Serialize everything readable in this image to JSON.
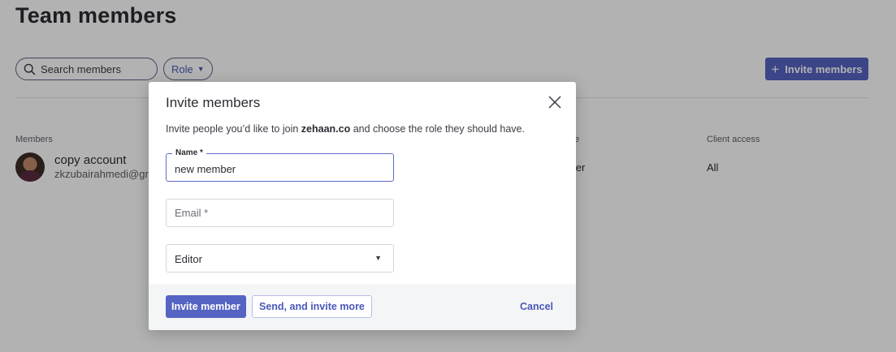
{
  "page": {
    "title": "Team members",
    "search": {
      "placeholder": "Search members"
    },
    "role_filter": {
      "label": "Role",
      "caret": "▼"
    },
    "invite_button": {
      "icon": "+",
      "label": "Invite members"
    },
    "columns": {
      "members": "Members",
      "role": "e",
      "client_access": "Client access"
    },
    "member": {
      "name": "copy account",
      "email": "zkzubairahmedi@gr",
      "role": "vner",
      "client_access": "All"
    }
  },
  "modal": {
    "title": "Invite members",
    "description_pre": "Invite people you’d like to join ",
    "description_org": "zehaan.co",
    "description_post": " and choose the role they should have.",
    "name_field": {
      "label": "Name *",
      "value": "new member"
    },
    "email_field": {
      "placeholder": "Email *"
    },
    "role_select": {
      "value": "Editor",
      "caret": "▼"
    },
    "buttons": {
      "invite": "Invite member",
      "invite_more": "Send, and invite more",
      "cancel": "Cancel"
    }
  },
  "colors": {
    "accent": "#5564c2",
    "overlay": "rgba(0,0,0,0.30)",
    "footer_bg": "#f4f5f7"
  },
  "icons": {
    "search": "search-icon",
    "close": "close-icon",
    "plus": "plus-icon",
    "caret": "chevron-down-icon"
  }
}
